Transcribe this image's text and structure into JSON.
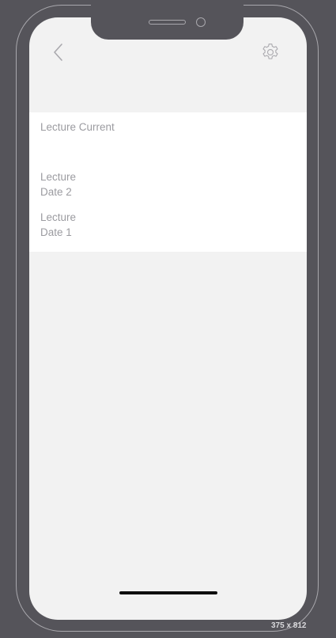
{
  "header": {
    "back_icon": "chevron-left-icon",
    "settings_icon": "gear-icon"
  },
  "lectures": {
    "current": "Lecture Current",
    "date2": "Lecture\nDate 2",
    "date1": "Lecture\nDate 1"
  },
  "device": {
    "size_label": "375 x 812"
  },
  "colors": {
    "background": "#55545a",
    "screen": "#f2f2f2",
    "panel": "#ffffff",
    "text_muted": "#9b9ba0",
    "icon": "#a9a8ad"
  }
}
